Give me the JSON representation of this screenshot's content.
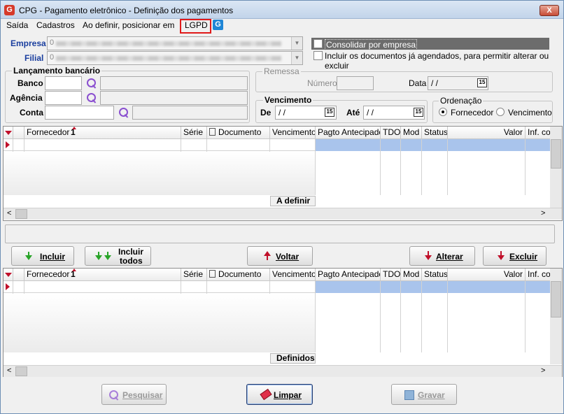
{
  "window": {
    "title": "CPG - Pagamento eletrônico - Definição dos pagamentos",
    "close_label": "X",
    "app_icon": "G"
  },
  "menu": {
    "items": [
      "Saída",
      "Cadastros",
      "Ao definir, posicionar em",
      "LGPD"
    ],
    "g_icon": "G"
  },
  "company": {
    "empresa_label": "Empresa",
    "filial_label": "Filial",
    "empresa_value": "0",
    "filial_value": "0",
    "consolidar_label": "Consolidar por empresa",
    "incluir_label": "Incluir os documentos já agendados, para permitir alterar ou excluir"
  },
  "lancamento": {
    "title": "Lançamento bancário",
    "banco_label": "Banco",
    "agencia_label": "Agência",
    "conta_label": "Conta"
  },
  "remessa": {
    "title": "Remessa",
    "numero_label": "Número",
    "data_label": "Data",
    "data_value": " /  /"
  },
  "vencimento": {
    "title": "Vencimento",
    "de_label": "De",
    "ate_label": "Até",
    "de_value": " /  /",
    "ate_value": " /  /"
  },
  "ordenacao": {
    "title": "Ordenação",
    "opt1": "Fornecedor",
    "opt2": "Vencimento",
    "selected": "Fornecedor"
  },
  "grid_columns": [
    "Fornecedor",
    "Série",
    "Documento",
    "Vencimento",
    "Pagto Antecipado",
    "TDO",
    "Mod",
    "Status",
    "Valor",
    "Inf. cor"
  ],
  "grid_sort_marker": "1",
  "grid_top_footer": "A definir",
  "grid_bottom_footer": "Definidos",
  "buttons": {
    "incluir": "Incluir",
    "incluir_todos_1": "Incluir",
    "incluir_todos_2": "todos",
    "voltar": "Voltar",
    "alterar": "Alterar",
    "excluir": "Excluir",
    "pesquisar": "Pesquisar",
    "limpar": "Limpar",
    "gravar": "Gravar"
  },
  "calendar_icon_text": "15",
  "scroll_left": "<",
  "scroll_right": ">"
}
